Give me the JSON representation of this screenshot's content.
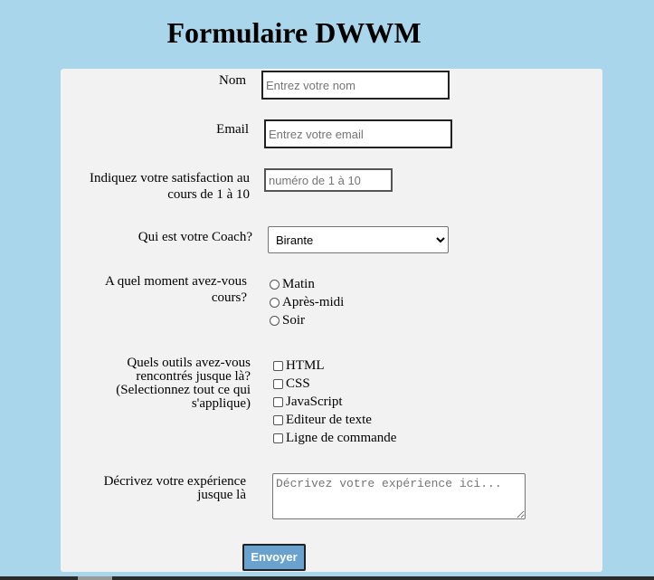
{
  "title": "Formulaire DWWM",
  "form": {
    "name": {
      "label": "Nom",
      "placeholder": "Entrez votre nom"
    },
    "email": {
      "label": "Email",
      "placeholder": "Entrez votre email"
    },
    "satisfaction": {
      "label_line1": "Indiquez votre satisfaction au",
      "label_line2": "cours de 1 à 10",
      "placeholder": "numéro de 1 à 10"
    },
    "coach": {
      "label": "Qui est votre Coach?",
      "selected": "Birante"
    },
    "moment": {
      "label_line1": "A quel moment avez-vous",
      "label_line2": "cours?",
      "options": [
        "Matin",
        "Après-midi",
        "Soir"
      ]
    },
    "tools": {
      "label_line1": "Quels outils avez-vous",
      "label_line2": "rencontrés jusque là?",
      "label_line3": "(Selectionnez tout ce qui",
      "label_line4": "s'applique)",
      "options": [
        "HTML",
        "CSS",
        "JavaScript",
        "Editeur de texte",
        "Ligne de commande"
      ]
    },
    "experience": {
      "label_line1": "Décrivez votre expérience",
      "label_line2": "jusque là",
      "placeholder": "Décrivez votre expérience ici..."
    },
    "submit_label": "Envoyer"
  },
  "colors": {
    "background": "#a9d6ea",
    "panel": "#f2f2f2",
    "button": "#6aa2cf"
  }
}
